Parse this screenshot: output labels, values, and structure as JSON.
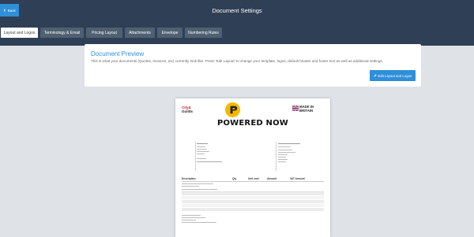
{
  "header": {
    "back_label": "Back",
    "title": "Document Settings"
  },
  "tabs": [
    {
      "label": "Layout and Logos",
      "active": true
    },
    {
      "label": "Terminology & Email",
      "active": false
    },
    {
      "label": "Pricing Layout",
      "active": false
    },
    {
      "label": "Attachments",
      "active": false
    },
    {
      "label": "Envelope",
      "active": false
    },
    {
      "label": "Numbering Rules",
      "active": false
    }
  ],
  "preview": {
    "title": "Document Preview",
    "description": "This is what your documents (Quotes, Invoices, etc) currently look like. Press 'Edit Layout' to change your template, logos, default header and footer text as well as additional settings.",
    "edit_label": "Edit Layout and Logos"
  },
  "document": {
    "left_logo": {
      "line1": "City&",
      "line2": "Guilds"
    },
    "center_logo": "POWERED NOW",
    "right_logo": {
      "line1": "MADE IN",
      "line2": "BRITAIN"
    },
    "table_headers": [
      "Description",
      "Qty",
      "Unit cost",
      "Amount",
      "VAT Amount"
    ],
    "colors": {
      "header": "#2f3f55",
      "accent": "#2f8fd8",
      "brand_yellow": "#f5b800",
      "tab": "#4f6072"
    }
  },
  "icons": {
    "back": "chevron-left-icon",
    "edit": "pencil-icon"
  }
}
